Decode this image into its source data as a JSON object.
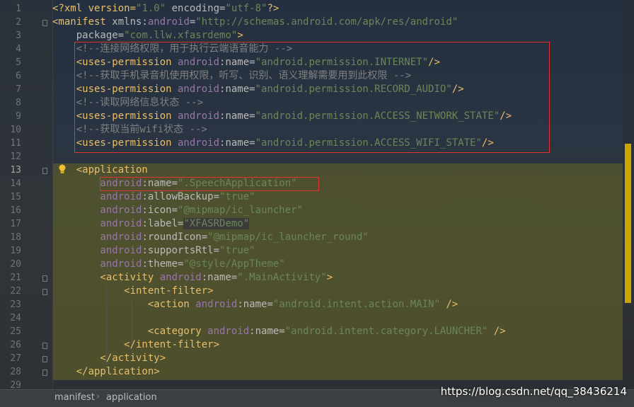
{
  "line_numbers": [
    "1",
    "2",
    "3",
    "4",
    "5",
    "6",
    "7",
    "8",
    "9",
    "10",
    "11",
    "12",
    "13",
    "14",
    "15",
    "16",
    "17",
    "18",
    "19",
    "20",
    "21",
    "22",
    "23",
    "24",
    "25",
    "26",
    "27",
    "28",
    "29"
  ],
  "code": {
    "l1": {
      "a": "<?xml version=",
      "b": "\"1.0\"",
      "c": " encoding=",
      "d": "\"utf-8\"",
      "e": "?>"
    },
    "l2": {
      "a": "<manifest",
      "b": " xmlns:",
      "c": "android",
      "d": "=",
      "e": "\"http://schemas.android.com/apk/res/android\""
    },
    "l3": {
      "a": "    package",
      "b": "=",
      "c": "\"com.llw.xfasrdemo\"",
      "d": ">"
    },
    "l4": {
      "a": "    <!--连接网络权限，用于执行云端语音能力 -->"
    },
    "l5": {
      "a": "    <uses-permission",
      "b": " android",
      "c": ":name=",
      "d": "\"android.permission.INTERNET\"",
      "e": "/>"
    },
    "l6": {
      "a": "    <!--获取手机录音机使用权限，听写、识别、语义理解需要用到此权限 -->"
    },
    "l7": {
      "a": "    <uses-permission",
      "b": " android",
      "c": ":name=",
      "d": "\"android.permission.RECORD_AUDIO\"",
      "e": "/>"
    },
    "l8": {
      "a": "    <!--读取网络信息状态 -->"
    },
    "l9": {
      "a": "    <uses-permission",
      "b": " android",
      "c": ":name=",
      "d": "\"android.permission.ACCESS_NETWORK_STATE\"",
      "e": "/>"
    },
    "l10": {
      "a": "    <!--获取当前wifi状态 -->"
    },
    "l11": {
      "a": "    <uses-permission",
      "b": " android",
      "c": ":name=",
      "d": "\"android.permission.ACCESS_WIFI_STATE\"",
      "e": "/>"
    },
    "l13": {
      "a": "    <application"
    },
    "l14": {
      "a": "        android",
      "b": ":name=",
      "c": "\".SpeechApplication\""
    },
    "l15": {
      "a": "        android",
      "b": ":allowBackup=",
      "c": "\"true\""
    },
    "l16": {
      "a": "        android",
      "b": ":icon=",
      "c": "\"@mipmap/ic_launcher\""
    },
    "l17": {
      "a": "        android",
      "b": ":label=",
      "c": "\"XFASRDemo\""
    },
    "l18": {
      "a": "        android",
      "b": ":roundIcon=",
      "c": "\"@mipmap/ic_launcher_round\""
    },
    "l19": {
      "a": "        android",
      "b": ":supportsRtl=",
      "c": "\"true\""
    },
    "l20": {
      "a": "        android",
      "b": ":theme=",
      "c": "\"@style/AppTheme\""
    },
    "l21": {
      "a": "        <activity",
      "b": " android",
      "c": ":name=",
      "d": "\".MainActivity\"",
      "e": ">"
    },
    "l22": {
      "a": "            <intent-filter>"
    },
    "l23": {
      "a": "                <action",
      "b": " android",
      "c": ":name=",
      "d": "\"android.intent.action.MAIN\"",
      "e": " />"
    },
    "l25": {
      "a": "                <category",
      "b": " android",
      "c": ":name=",
      "d": "\"android.intent.category.LAUNCHER\"",
      "e": " />"
    },
    "l26": {
      "a": "            </intent-filter>"
    },
    "l27": {
      "a": "        </activity>"
    },
    "l28": {
      "a": "    </application>"
    }
  },
  "breadcrumb": {
    "item1": "manifest",
    "sep": "›",
    "item2": "application"
  },
  "watermark": "https://blog.csdn.net/qq_38436214",
  "colors": {
    "tag": "#e8bf6a",
    "namespace": "#9876aa",
    "value": "#6a8759",
    "comment": "#808080",
    "highlight_box": "#e0322e"
  }
}
